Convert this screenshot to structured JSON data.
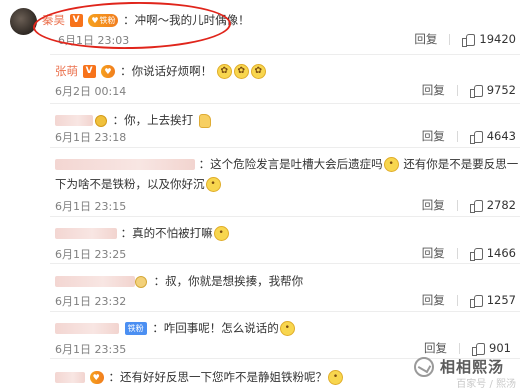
{
  "comments": [
    {
      "user": "秦昊",
      "text": "：冲啊～我的儿时偶像！",
      "time": "6月1日 23:03",
      "reply": "回复",
      "likes": "19420"
    },
    {
      "user": "张萌",
      "text": "：你说话好烦啊！",
      "time": "6月2日 00:14",
      "reply": "回复",
      "likes": "9752"
    },
    {
      "text": "：你，上去挨打",
      "time": "6月1日 23:18",
      "reply": "回复",
      "likes": "4643"
    },
    {
      "text_line1": "：这个危险发言是吐槽大会后遗症吗",
      "text_line1b": "还有你是不是要反思一",
      "text_line2": "下为啥不是铁粉，以及你好沉",
      "time": "6月1日 23:15",
      "reply": "回复",
      "likes": "2782"
    },
    {
      "text": "：真的不怕被打嘛",
      "time": "6月1日 23:25",
      "reply": "回复",
      "likes": "1466"
    },
    {
      "text": "：叔，你就是想挨揍，我帮你",
      "time": "6月1日 23:32",
      "reply": "回复",
      "likes": "1257"
    },
    {
      "badge": "铁粉",
      "text": "：咋回事呢！怎么说话的",
      "time": "6月1日 23:35",
      "reply": "回复",
      "likes": "901"
    },
    {
      "text": "：还有好好反思一下您咋不是静姐铁粉呢？"
    }
  ],
  "badges": {
    "vip": "V",
    "fan": "铁粉"
  },
  "watermark": {
    "title": "相相熙汤",
    "sub": "百家号 / 熙汤"
  },
  "colors": {
    "username": "#eb7350",
    "highlight": "#e0251b",
    "vip": "#f7731b"
  }
}
